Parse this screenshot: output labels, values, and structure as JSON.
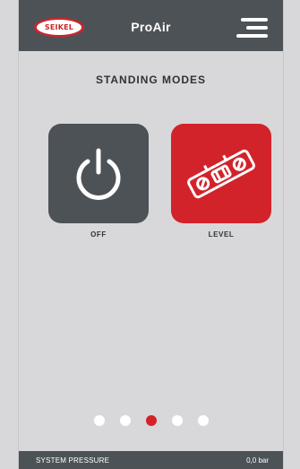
{
  "header": {
    "logo_text": "SEIKEL",
    "title": "ProAir",
    "menu_icon": "hamburger-menu-icon"
  },
  "main": {
    "title": "STANDING MODES",
    "modes": [
      {
        "label": "OFF",
        "icon": "power-icon",
        "color": "#4d5257"
      },
      {
        "label": "LEVEL",
        "icon": "spirit-level-icon",
        "color": "#d2232a"
      }
    ]
  },
  "pager": {
    "pages": 5,
    "active_index": 2,
    "active_color": "#d2232a"
  },
  "footer": {
    "label": "SYSTEM PRESSURE",
    "value": "0,0 bar"
  },
  "colors": {
    "header_bg": "#4d5257",
    "background": "#d8d8da",
    "accent": "#d2232a"
  }
}
